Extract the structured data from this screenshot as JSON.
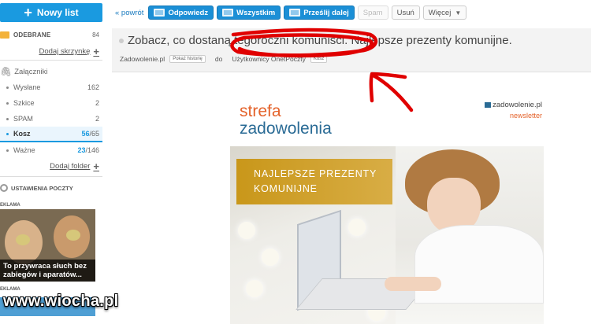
{
  "sidebar": {
    "new_list_label": "Nowy list",
    "inbox_label": "ODEBRANE",
    "inbox_count": "84",
    "add_mailbox_label": "Dodaj skrzynkę",
    "attachments_label": "Załączniki",
    "folders": [
      {
        "label": "Wysłane",
        "count_main": "",
        "count_rest": "162"
      },
      {
        "label": "Szkice",
        "count_main": "",
        "count_rest": "2"
      },
      {
        "label": "SPAM",
        "count_main": "",
        "count_rest": "2"
      },
      {
        "label": "Kosz",
        "count_main": "56",
        "count_rest": "/65"
      },
      {
        "label": "Ważne",
        "count_main": "23",
        "count_rest": "/146"
      }
    ],
    "add_folder_label": "Dodaj folder",
    "settings_label": "USTAWIENIA POCZTY",
    "ad_label_1": "EKLAMA",
    "ad_caption": "To przywraca słuch bez zabiegów i aparatów...",
    "ad_label_2": "EKLAMA"
  },
  "toolbar": {
    "back_label": "« powrót",
    "reply_label": "Odpowiedz",
    "reply_all_label": "Wszystkim",
    "forward_label": "Prześlij dalej",
    "spam_label": "Spam",
    "delete_label": "Usuń",
    "more_label": "Więcej"
  },
  "message": {
    "subject": "Zobacz, co dostaną tegoroczni komuniści. Najlepsze prezenty komunijne.",
    "sender": "Zadowolenie.pl",
    "show_history_label": "Pokaż historię",
    "to_label": "do",
    "recipient": "Użytkownicy OnetPoczty",
    "trash_badge": "Kosz"
  },
  "newsletter": {
    "strefa": "strefa",
    "zadowolenia": "zadowolenia",
    "brand": "zadowolenie.pl",
    "brand_sub": "newsletter",
    "promo_line1": "NAJLEPSZE PREZENTY",
    "promo_line2": "KOMUNIJNE"
  },
  "watermark": "www.wiocha.pl",
  "colors": {
    "accent_blue": "#1a9ae0",
    "annotation_red": "#e00000",
    "brand_orange": "#e4622a",
    "brand_navy": "#2a6b95",
    "promo_gold": "#c9971a"
  }
}
